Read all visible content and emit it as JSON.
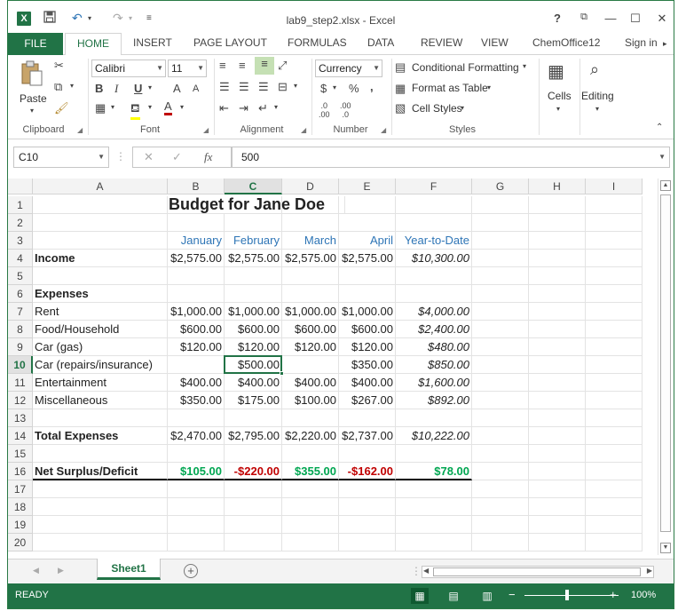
{
  "window": {
    "title": "lab9_step2.xlsx - Excel",
    "help": "?",
    "restore": "⧉",
    "minimize": "—",
    "maximize": "☐",
    "close": "✕"
  },
  "ribbon_tabs": {
    "file": "FILE",
    "tabs": [
      "HOME",
      "INSERT",
      "PAGE LAYOUT",
      "FORMULAS",
      "DATA",
      "REVIEW",
      "VIEW",
      "ChemOffice12"
    ],
    "active": "HOME",
    "sign_in": "Sign in"
  },
  "ribbon": {
    "clipboard": {
      "label": "Clipboard",
      "paste": "Paste"
    },
    "font": {
      "label": "Font",
      "name": "Calibri",
      "size": "11",
      "bold": "B",
      "italic": "I",
      "underline": "U",
      "grow": "A",
      "shrink": "A",
      "font_color": "A"
    },
    "alignment": {
      "label": "Alignment"
    },
    "number": {
      "label": "Number",
      "format": "Currency",
      "currency": "$",
      "percent": "%",
      "comma": ","
    },
    "styles": {
      "label": "Styles",
      "conditional": "Conditional Formatting",
      "table": "Format as Table",
      "cell_styles": "Cell Styles"
    },
    "cells": {
      "label": "Cells"
    },
    "editing": {
      "label": "Editing"
    }
  },
  "formula_bar": {
    "name_box": "C10",
    "fx": "fx",
    "value": "500"
  },
  "columns": [
    "A",
    "B",
    "C",
    "D",
    "E",
    "F",
    "G",
    "H",
    "I"
  ],
  "selected_column": "C",
  "selected_row": "10",
  "rows": [
    {
      "n": "1",
      "A": "",
      "B": "Budget for Jane Doe",
      "C": "",
      "D": "",
      "E": "",
      "F": ""
    },
    {
      "n": "2",
      "A": "",
      "B": "",
      "C": "",
      "D": "",
      "E": "",
      "F": ""
    },
    {
      "n": "3",
      "A": "",
      "B": "January",
      "C": "February",
      "D": "March",
      "E": "April",
      "F": "Year-to-Date"
    },
    {
      "n": "4",
      "A": "Income",
      "B": "$2,575.00",
      "C": "$2,575.00",
      "D": "$2,575.00",
      "E": "$2,575.00",
      "F": "$10,300.00"
    },
    {
      "n": "5",
      "A": "",
      "B": "",
      "C": "",
      "D": "",
      "E": "",
      "F": ""
    },
    {
      "n": "6",
      "A": "Expenses",
      "B": "",
      "C": "",
      "D": "",
      "E": "",
      "F": ""
    },
    {
      "n": "7",
      "A": "Rent",
      "B": "$1,000.00",
      "C": "$1,000.00",
      "D": "$1,000.00",
      "E": "$1,000.00",
      "F": "$4,000.00"
    },
    {
      "n": "8",
      "A": "Food/Household",
      "B": "$600.00",
      "C": "$600.00",
      "D": "$600.00",
      "E": "$600.00",
      "F": "$2,400.00"
    },
    {
      "n": "9",
      "A": "Car (gas)",
      "B": "$120.00",
      "C": "$120.00",
      "D": "$120.00",
      "E": "$120.00",
      "F": "$480.00"
    },
    {
      "n": "10",
      "A": "Car (repairs/insurance)",
      "B": "",
      "C": "$500.00",
      "D": "",
      "E": "$350.00",
      "F": "$850.00"
    },
    {
      "n": "11",
      "A": "Entertainment",
      "B": "$400.00",
      "C": "$400.00",
      "D": "$400.00",
      "E": "$400.00",
      "F": "$1,600.00"
    },
    {
      "n": "12",
      "A": "Miscellaneous",
      "B": "$350.00",
      "C": "$175.00",
      "D": "$100.00",
      "E": "$267.00",
      "F": "$892.00"
    },
    {
      "n": "13",
      "A": "",
      "B": "",
      "C": "",
      "D": "",
      "E": "",
      "F": ""
    },
    {
      "n": "14",
      "A": "Total Expenses",
      "B": "$2,470.00",
      "C": "$2,795.00",
      "D": "$2,220.00",
      "E": "$2,737.00",
      "F": "$10,222.00"
    },
    {
      "n": "15",
      "A": "",
      "B": "",
      "C": "",
      "D": "",
      "E": "",
      "F": ""
    },
    {
      "n": "16",
      "A": "Net Surplus/Deficit",
      "B": "$105.00",
      "C": "-$220.00",
      "D": "$355.00",
      "E": "-$162.00",
      "F": "$78.00"
    },
    {
      "n": "17",
      "A": "",
      "B": "",
      "C": "",
      "D": "",
      "E": "",
      "F": ""
    },
    {
      "n": "18",
      "A": "",
      "B": "",
      "C": "",
      "D": "",
      "E": "",
      "F": ""
    },
    {
      "n": "19",
      "A": "",
      "B": "",
      "C": "",
      "D": "",
      "E": "",
      "F": ""
    },
    {
      "n": "20",
      "A": "",
      "B": "",
      "C": "",
      "D": "",
      "E": "",
      "F": ""
    }
  ],
  "colors": {
    "excel_green": "#217346",
    "header_blue": "#2e75b6",
    "positive_green": "#00a651",
    "negative_red": "#c00000"
  },
  "sheets": {
    "active": "Sheet1",
    "add": "+"
  },
  "status": {
    "mode": "READY",
    "zoom": "100%",
    "zoom_minus": "−",
    "zoom_plus": "+"
  }
}
